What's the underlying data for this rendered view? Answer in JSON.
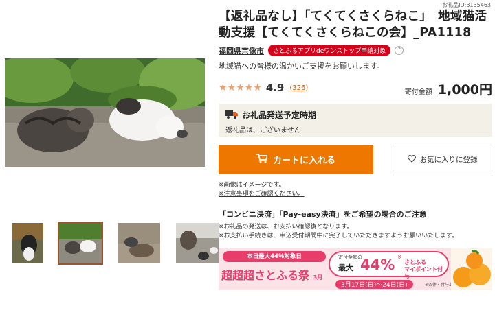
{
  "item_id": "お礼品ID:3135463",
  "title": "【返礼品なし】「てくてくさくらねこ」　地域猫活動支援【てくてくさくらねこの会】_PA1118",
  "location": "福岡県宗像市",
  "badge": "さとふるアプリdeワンストップ申請対象",
  "help": "?",
  "description": "地域猫への皆様の温かいご支援をお願いします。",
  "rating": {
    "stars": "★★★★★",
    "value": 4.9,
    "score": "4.9",
    "reviews": "(326)"
  },
  "price": {
    "label": "寄付金額",
    "amount": "1,000円"
  },
  "shipping": {
    "title": "お礼品発送予定時期",
    "detail": "返礼品は、ございません"
  },
  "buttons": {
    "cart": "カートに入れる",
    "favorite": "お気に入りに登録"
  },
  "notes": [
    "※画像はイメージです。",
    "※注意事項をご確認ください。"
  ],
  "payment": {
    "heading": "「コンビニ決済」「Pay-easy決済」をご希望の場合のご注意",
    "lines": [
      "※お礼品の発送は、お支払い確認後となります。",
      "※お支払い手続きは、申込受付期間中に完了していただきますようお願いいたします。"
    ]
  },
  "banner": {
    "top": "本日最大44％対象日",
    "month": "3月",
    "main": "超超超さとふる祭",
    "pct_label": "寄付金額の",
    "max": "最大",
    "pct": "44%",
    "mark": "※",
    "pt": "さとふる\nマイポイント付与",
    "date": "3月17日(日)〜24日(日)",
    "note": "※条件・付与上限あり"
  },
  "icons": {
    "truck": "truck-icon",
    "cart": "cart-icon",
    "heart": "heart-icon"
  },
  "colors": {
    "accent": "#ee7700",
    "badge": "#d7001a",
    "banner": "#e63d6a",
    "star": "#e8a070"
  }
}
